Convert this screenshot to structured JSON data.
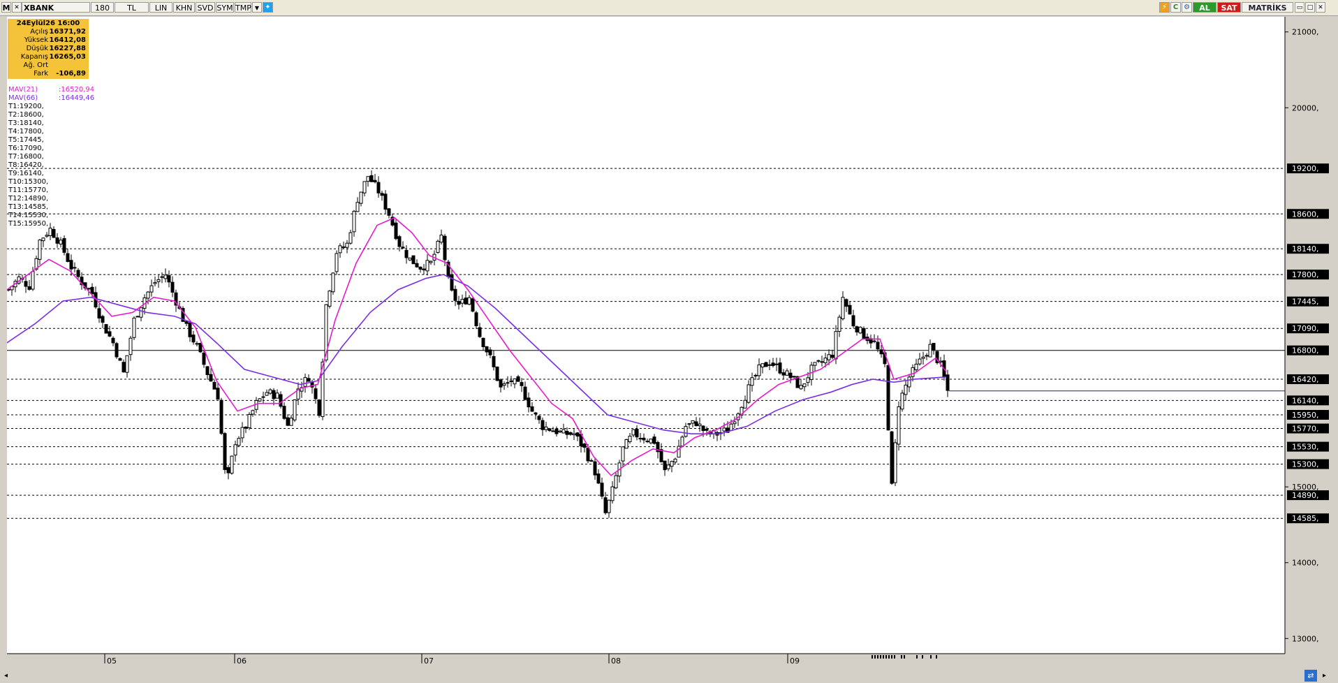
{
  "toolbar": {
    "app_mark": "M",
    "symbol": "XBANK",
    "period": "180",
    "currency": "TL",
    "buttons": [
      "LIN",
      "KHN",
      "SVD",
      "SYM",
      "TMP"
    ],
    "al_label": "AL",
    "sat_label": "SAT",
    "brand": "MATRİKS"
  },
  "info_box": {
    "title": "24Eylül26 16:00",
    "rows": [
      {
        "label": "Açılış",
        "value": "16371,92"
      },
      {
        "label": "Yüksek",
        "value": "16412,08"
      },
      {
        "label": "Düşük",
        "value": "16227,88"
      },
      {
        "label": "Kapanış",
        "value": "16265,03"
      },
      {
        "label": "Ağ. Ort",
        "value": ""
      },
      {
        "label": "Fark",
        "value": "-106,89"
      }
    ]
  },
  "indicators": [
    {
      "label": "MAV(21)",
      "value": ":16520,94",
      "color": "#e619d0"
    },
    {
      "label": "MAV(66)",
      "value": ":16449,46",
      "color": "#7a2ee6"
    }
  ],
  "levels_list": [
    "T1:19200,",
    "T2:18600,",
    "T3:18140,",
    "T4:17800,",
    "T5:17445,",
    "T6:17090,",
    "T7:16800,",
    "T8:16420,",
    "T9:16140,",
    "T10:15300,",
    "T11:15770,",
    "T12:14890,",
    "T13:14585,",
    "T14:15530,",
    "T15:15950,"
  ],
  "colors": {
    "mav21": "#e619d0",
    "mav66": "#7a2ee6",
    "candle": "#000000",
    "info_bg": "#f4c33a",
    "last_line": "#1a1a8c"
  },
  "chart_data": {
    "type": "candlestick",
    "y_axis": {
      "range": [
        12800,
        21200
      ],
      "ticks": [
        13000,
        14000,
        15000,
        20000,
        21000
      ]
    },
    "x_axis": {
      "months": [
        "05",
        "06",
        "07",
        "08",
        "09"
      ]
    },
    "level_lines": [
      19200,
      18600,
      18140,
      17800,
      17445,
      17090,
      16800,
      16420,
      16140,
      15950,
      15770,
      15530,
      15300,
      14890,
      14585
    ],
    "level_labels": [
      "19200,",
      "18600,",
      "18140,",
      "17800,",
      "17445,",
      "17090,",
      "16800,",
      "16420,",
      "16140,",
      "15950,",
      "15770,",
      "15530,",
      "15300,",
      "14890,",
      "14585,"
    ],
    "solid_level": 16800,
    "last_close": 16265.03,
    "close_path": [
      [
        0,
        17600
      ],
      [
        15,
        17750
      ],
      [
        30,
        17650
      ],
      [
        45,
        18250
      ],
      [
        60,
        18400
      ],
      [
        75,
        18200
      ],
      [
        90,
        17900
      ],
      [
        105,
        17700
      ],
      [
        120,
        17550
      ],
      [
        135,
        17150
      ],
      [
        150,
        16900
      ],
      [
        165,
        16500
      ],
      [
        180,
        17200
      ],
      [
        195,
        17500
      ],
      [
        210,
        17700
      ],
      [
        225,
        17800
      ],
      [
        240,
        17450
      ],
      [
        255,
        17100
      ],
      [
        270,
        16850
      ],
      [
        285,
        16500
      ],
      [
        300,
        16200
      ],
      [
        312,
        15000
      ],
      [
        325,
        15600
      ],
      [
        340,
        15800
      ],
      [
        355,
        16100
      ],
      [
        370,
        16250
      ],
      [
        385,
        16200
      ],
      [
        400,
        15800
      ],
      [
        415,
        16300
      ],
      [
        430,
        16450
      ],
      [
        445,
        16000
      ],
      [
        455,
        17400
      ],
      [
        470,
        18100
      ],
      [
        485,
        18200
      ],
      [
        500,
        18800
      ],
      [
        515,
        19100
      ],
      [
        530,
        18900
      ],
      [
        545,
        18600
      ],
      [
        560,
        18200
      ],
      [
        575,
        18000
      ],
      [
        590,
        17900
      ],
      [
        605,
        17950
      ],
      [
        620,
        18300
      ],
      [
        632,
        17600
      ],
      [
        645,
        17400
      ],
      [
        660,
        17500
      ],
      [
        675,
        17000
      ],
      [
        690,
        16700
      ],
      [
        705,
        16300
      ],
      [
        720,
        16400
      ],
      [
        735,
        16300
      ],
      [
        750,
        16000
      ],
      [
        765,
        15800
      ],
      [
        780,
        15750
      ],
      [
        795,
        15700
      ],
      [
        810,
        15700
      ],
      [
        825,
        15500
      ],
      [
        840,
        15200
      ],
      [
        855,
        14650
      ],
      [
        865,
        14950
      ],
      [
        880,
        15500
      ],
      [
        895,
        15700
      ],
      [
        910,
        15650
      ],
      [
        925,
        15600
      ],
      [
        940,
        15200
      ],
      [
        955,
        15400
      ],
      [
        970,
        15800
      ],
      [
        985,
        15850
      ],
      [
        1000,
        15700
      ],
      [
        1015,
        15700
      ],
      [
        1030,
        15750
      ],
      [
        1045,
        16000
      ],
      [
        1060,
        16300
      ],
      [
        1075,
        16550
      ],
      [
        1090,
        16650
      ],
      [
        1105,
        16550
      ],
      [
        1120,
        16450
      ],
      [
        1135,
        16300
      ],
      [
        1150,
        16550
      ],
      [
        1165,
        16650
      ],
      [
        1180,
        16750
      ],
      [
        1195,
        17500
      ],
      [
        1210,
        17150
      ],
      [
        1225,
        17000
      ],
      [
        1240,
        16900
      ],
      [
        1255,
        16600
      ],
      [
        1265,
        15000
      ],
      [
        1275,
        16100
      ],
      [
        1290,
        16450
      ],
      [
        1305,
        16650
      ],
      [
        1320,
        16850
      ],
      [
        1335,
        16600
      ],
      [
        1345,
        16265
      ]
    ],
    "mav21_path": [
      [
        0,
        17600
      ],
      [
        30,
        17800
      ],
      [
        60,
        18000
      ],
      [
        90,
        17850
      ],
      [
        120,
        17550
      ],
      [
        150,
        17250
      ],
      [
        180,
        17300
      ],
      [
        210,
        17500
      ],
      [
        240,
        17450
      ],
      [
        270,
        17100
      ],
      [
        300,
        16400
      ],
      [
        330,
        16000
      ],
      [
        360,
        16100
      ],
      [
        390,
        16100
      ],
      [
        420,
        16300
      ],
      [
        445,
        16350
      ],
      [
        470,
        17200
      ],
      [
        500,
        17950
      ],
      [
        530,
        18450
      ],
      [
        555,
        18550
      ],
      [
        580,
        18350
      ],
      [
        605,
        18050
      ],
      [
        630,
        17950
      ],
      [
        660,
        17600
      ],
      [
        690,
        17200
      ],
      [
        720,
        16800
      ],
      [
        750,
        16450
      ],
      [
        780,
        16100
      ],
      [
        810,
        15900
      ],
      [
        840,
        15400
      ],
      [
        865,
        15150
      ],
      [
        895,
        15350
      ],
      [
        925,
        15500
      ],
      [
        955,
        15450
      ],
      [
        985,
        15650
      ],
      [
        1015,
        15750
      ],
      [
        1045,
        15900
      ],
      [
        1075,
        16150
      ],
      [
        1105,
        16350
      ],
      [
        1135,
        16450
      ],
      [
        1165,
        16550
      ],
      [
        1195,
        16750
      ],
      [
        1225,
        16950
      ],
      [
        1250,
        16950
      ],
      [
        1270,
        16420
      ],
      [
        1300,
        16500
      ],
      [
        1330,
        16700
      ],
      [
        1345,
        16520
      ]
    ],
    "mav66_path": [
      [
        0,
        16900
      ],
      [
        40,
        17150
      ],
      [
        80,
        17450
      ],
      [
        120,
        17500
      ],
      [
        160,
        17400
      ],
      [
        200,
        17300
      ],
      [
        240,
        17250
      ],
      [
        270,
        17150
      ],
      [
        300,
        16900
      ],
      [
        340,
        16550
      ],
      [
        380,
        16450
      ],
      [
        420,
        16350
      ],
      [
        445,
        16400
      ],
      [
        480,
        16850
      ],
      [
        520,
        17300
      ],
      [
        560,
        17600
      ],
      [
        600,
        17750
      ],
      [
        625,
        17800
      ],
      [
        660,
        17650
      ],
      [
        700,
        17350
      ],
      [
        740,
        17000
      ],
      [
        780,
        16650
      ],
      [
        820,
        16300
      ],
      [
        860,
        15950
      ],
      [
        900,
        15850
      ],
      [
        940,
        15750
      ],
      [
        980,
        15700
      ],
      [
        1020,
        15700
      ],
      [
        1060,
        15800
      ],
      [
        1100,
        16000
      ],
      [
        1140,
        16150
      ],
      [
        1180,
        16250
      ],
      [
        1210,
        16350
      ],
      [
        1240,
        16420
      ],
      [
        1270,
        16380
      ],
      [
        1300,
        16420
      ],
      [
        1330,
        16440
      ],
      [
        1345,
        16449
      ]
    ]
  }
}
